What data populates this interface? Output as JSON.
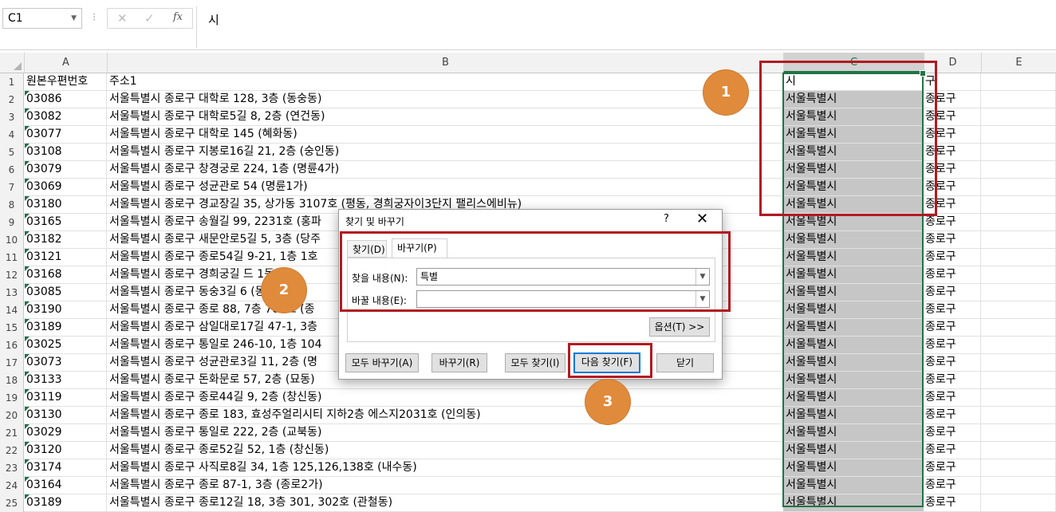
{
  "formula_bar": {
    "name_box": "C1",
    "formula": "시",
    "cancel_icon": "✕",
    "enter_icon": "✓",
    "fx_icon": "fx",
    "separator": "⁝"
  },
  "columns": [
    "A",
    "B",
    "C",
    "D",
    "E"
  ],
  "rows": [
    {
      "num": "1",
      "a": "원본우편번호",
      "b": "주소1",
      "c": "시",
      "d": "구"
    },
    {
      "num": "2",
      "a": "03086",
      "b": "서울특별시 종로구 대학로 128, 3층 (동숭동)",
      "c": "서울특별시",
      "d": "종로구"
    },
    {
      "num": "3",
      "a": "03082",
      "b": "서울특별시 종로구 대학로5길 8, 2층 (연건동)",
      "c": "서울특별시",
      "d": "종로구"
    },
    {
      "num": "4",
      "a": "03077",
      "b": "서울특별시 종로구 대학로 145 (혜화동)",
      "c": "서울특별시",
      "d": "종로구"
    },
    {
      "num": "5",
      "a": "03108",
      "b": "서울특별시 종로구 지봉로16길 21, 2층 (숭인동)",
      "c": "서울특별시",
      "d": "종로구"
    },
    {
      "num": "6",
      "a": "03079",
      "b": "서울특별시 종로구 창경궁로 224, 1층 (명륜4가)",
      "c": "서울특별시",
      "d": "종로구"
    },
    {
      "num": "7",
      "a": "03069",
      "b": "서울특별시 종로구 성균관로 54 (명륜1가)",
      "c": "서울특별시",
      "d": "종로구"
    },
    {
      "num": "8",
      "a": "03180",
      "b": "서울특별시 종로구 경교장길 35, 상가동 3107호 (평동, 경희궁자이3단지 팰리스에비뉴)",
      "c": "서울특별시",
      "d": "종로구"
    },
    {
      "num": "9",
      "a": "03165",
      "b": "서울특별시 종로구 송월길 99, 2231호 (홍파",
      "c": "서울특별시",
      "d": "종로구"
    },
    {
      "num": "10",
      "a": "03182",
      "b": "서울특별시 종로구 새문안로5길 5, 3층 (당주",
      "c": "서울특별시",
      "d": "종로구"
    },
    {
      "num": "11",
      "a": "03121",
      "b": "서울특별시 종로구 종로54길 9-21, 1층 1호",
      "c": "서울특별시",
      "d": "종로구"
    },
    {
      "num": "12",
      "a": "03168",
      "b": "서울특별시 종로구 경희궁길 드 1동 B",
      "c": "서울특별시",
      "d": "종로구"
    },
    {
      "num": "13",
      "a": "03085",
      "b": "서울특별시 종로구 동숭3길 6 (동숭동",
      "c": "서울특별시",
      "d": "종로구"
    },
    {
      "num": "14",
      "a": "03190",
      "b": "서울특별시 종로구 종로 88, 7층 701호 (종",
      "c": "서울특별시",
      "d": "종로구"
    },
    {
      "num": "15",
      "a": "03189",
      "b": "서울특별시 종로구 삼일대로17길 47-1, 3층",
      "c": "서울특별시",
      "d": "종로구"
    },
    {
      "num": "16",
      "a": "03025",
      "b": "서울특별시 종로구 통일로 246-10, 1층 104",
      "c": "서울특별시",
      "d": "종로구"
    },
    {
      "num": "17",
      "a": "03073",
      "b": "서울특별시 종로구 성균관로3길 11, 2층 (명",
      "c": "서울특별시",
      "d": "종로구"
    },
    {
      "num": "18",
      "a": "03133",
      "b": "서울특별시 종로구 돈화문로 57, 2층 (묘동)",
      "c": "서울특별시",
      "d": "종로구"
    },
    {
      "num": "19",
      "a": "03119",
      "b": "서울특별시 종로구 종로44길 9, 2층 (창신동)",
      "c": "서울특별시",
      "d": "종로구"
    },
    {
      "num": "20",
      "a": "03130",
      "b": "서울특별시 종로구 종로 183, 효성주얼리시티 지하2층 에스지2031호 (인의동)",
      "c": "서울특별시",
      "d": "종로구"
    },
    {
      "num": "21",
      "a": "03029",
      "b": "서울특별시 종로구 통일로 222, 2층 (교북동)",
      "c": "서울특별시",
      "d": "종로구"
    },
    {
      "num": "22",
      "a": "03120",
      "b": "서울특별시 종로구 종로52길 52, 1층 (창신동)",
      "c": "서울특별시",
      "d": "종로구"
    },
    {
      "num": "23",
      "a": "03174",
      "b": "서울특별시 종로구 사직로8길 34, 1층 125,126,138호 (내수동)",
      "c": "서울특별시",
      "d": "종로구"
    },
    {
      "num": "24",
      "a": "03164",
      "b": "서울특별시 종로구 종로 87-1, 3층 (종로2가)",
      "c": "서울특별시",
      "d": "종로구"
    },
    {
      "num": "25",
      "a": "03189",
      "b": "서울특별시 종로구 종로12길 18, 3층 301, 302호 (관철동)",
      "c": "서울특별시",
      "d": "종로구"
    }
  ],
  "dialog": {
    "title": "찾기 및 바꾸기",
    "help": "?",
    "close": "✕",
    "tab_find": "찾기(D)",
    "tab_replace": "바꾸기(P)",
    "find_label": "찾을 내용(N):",
    "find_value": "특별",
    "replace_label": "바꿀 내용(E):",
    "replace_value": "",
    "options_btn": "옵션(T) >>",
    "replace_all_btn": "모두 바꾸기(A)",
    "replace_btn": "바꾸기(R)",
    "find_all_btn": "모두 찾기(I)",
    "find_next_btn": "다음 찾기(F)",
    "close_btn": "닫기"
  },
  "callouts": [
    "1",
    "2",
    "3"
  ],
  "colors": {
    "highlight_red": "#b11a20",
    "callout_orange": "#e08a3c",
    "excel_green": "#217346"
  }
}
